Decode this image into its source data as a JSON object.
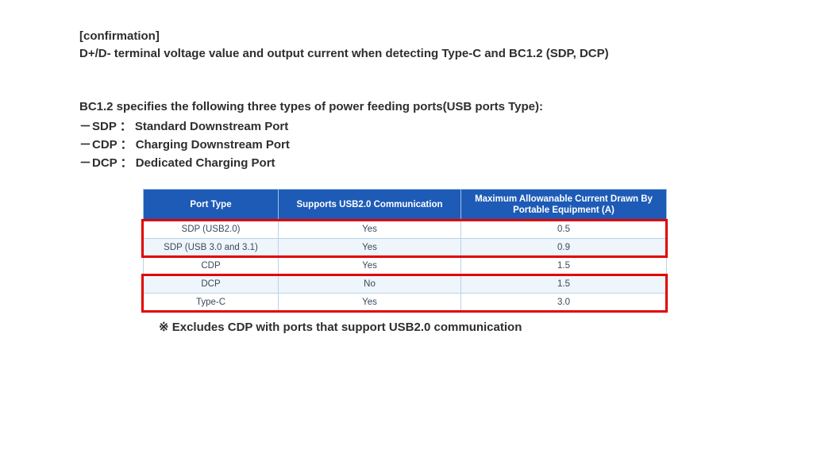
{
  "title": {
    "line1": "[confirmation]",
    "line2": "D+/D- terminal voltage value and output current when detecting Type-C and BC1.2 (SDP, DCP)"
  },
  "spec_intro": "BC1.2 specifies the following three types of power feeding ports(USB ports Type):",
  "ports": [
    {
      "abbr": "SDP",
      "name": "Standard Downstream Port"
    },
    {
      "abbr": "CDP",
      "name": "Charging Downstream Port"
    },
    {
      "abbr": "DCP",
      "name": "Dedicated Charging Port"
    }
  ],
  "table": {
    "headers": {
      "port_type": "Port Type",
      "supports": "Supports USB2.0 Communication",
      "max_current": "Maximum Allowanable Current Drawn By Portable Equipment (A)"
    },
    "rows": [
      {
        "port_type": "SDP (USB2.0)",
        "supports": "Yes",
        "max_current": "0.5"
      },
      {
        "port_type": "SDP (USB 3.0 and 3.1)",
        "supports": "Yes",
        "max_current": "0.9"
      },
      {
        "port_type": "CDP",
        "supports": "Yes",
        "max_current": "1.5"
      },
      {
        "port_type": "DCP",
        "supports": "No",
        "max_current": "1.5"
      },
      {
        "port_type": "Type-C",
        "supports": "Yes",
        "max_current": "3.0"
      }
    ]
  },
  "footnote": "※ Excludes CDP with ports that support USB2.0 communication",
  "chart_data": {
    "type": "table",
    "columns": [
      "Port Type",
      "Supports USB2.0 Communication",
      "Maximum Allowanable Current Drawn By Portable Equipment (A)"
    ],
    "rows": [
      [
        "SDP (USB2.0)",
        "Yes",
        0.5
      ],
      [
        "SDP (USB 3.0 and 3.1)",
        "Yes",
        0.9
      ],
      [
        "CDP",
        "Yes",
        1.5
      ],
      [
        "DCP",
        "No",
        1.5
      ],
      [
        "Type-C",
        "Yes",
        3.0
      ]
    ],
    "highlighted_row_groups": [
      [
        0,
        1
      ],
      [
        3,
        4
      ]
    ]
  }
}
